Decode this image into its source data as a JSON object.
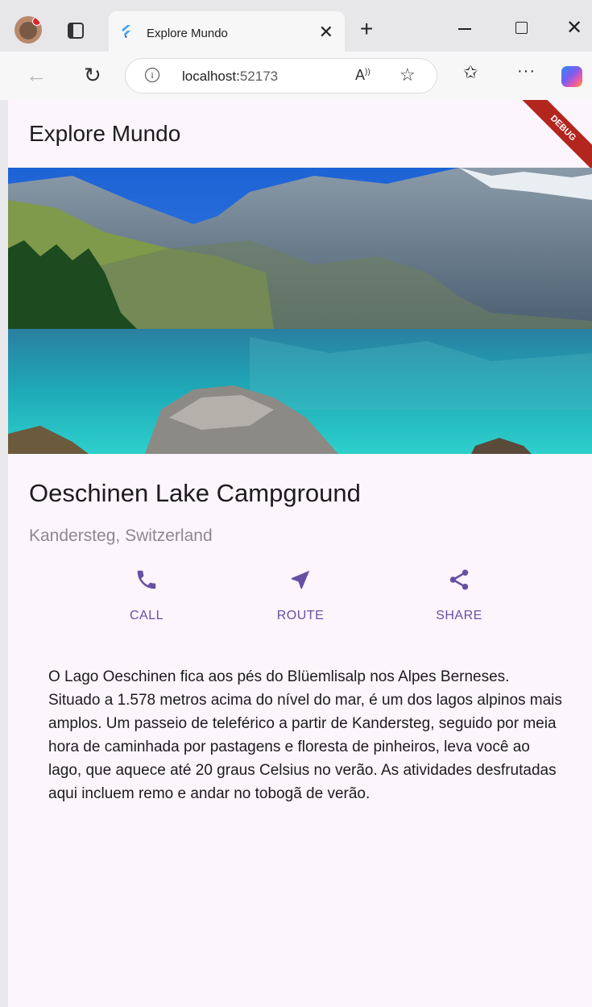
{
  "browser": {
    "tab_title": "Explore Mundo",
    "address_host": "localhost:",
    "address_port": "52173",
    "info_icon": "i"
  },
  "app": {
    "title": "Explore Mundo",
    "debug_banner": "DEBUG"
  },
  "place": {
    "name": "Oeschinen Lake Campground",
    "location": "Kandersteg, Switzerland"
  },
  "actions": [
    {
      "label": "CALL",
      "icon": "phone-icon"
    },
    {
      "label": "ROUTE",
      "icon": "navigation-arrow-icon"
    },
    {
      "label": "SHARE",
      "icon": "share-icon"
    }
  ],
  "description": "O Lago Oeschinen fica aos pés do Blüemlisalp nos Alpes Berneses. Situado a 1.578 metros acima do nível do mar, é um dos lagos alpinos mais amplos. Um passeio de teleférico a partir de Kandersteg, seguido por meia hora de caminhada por pastagens e floresta de pinheiros, leva você ao lago, que aquece até 20 graus Celsius no verão. As atividades desfrutadas aqui incluem remo e andar no tobogã de verão.",
  "colors": {
    "accent": "#6750a4",
    "app_background": "#fcf5fc",
    "debug_banner": "#b3261e"
  }
}
